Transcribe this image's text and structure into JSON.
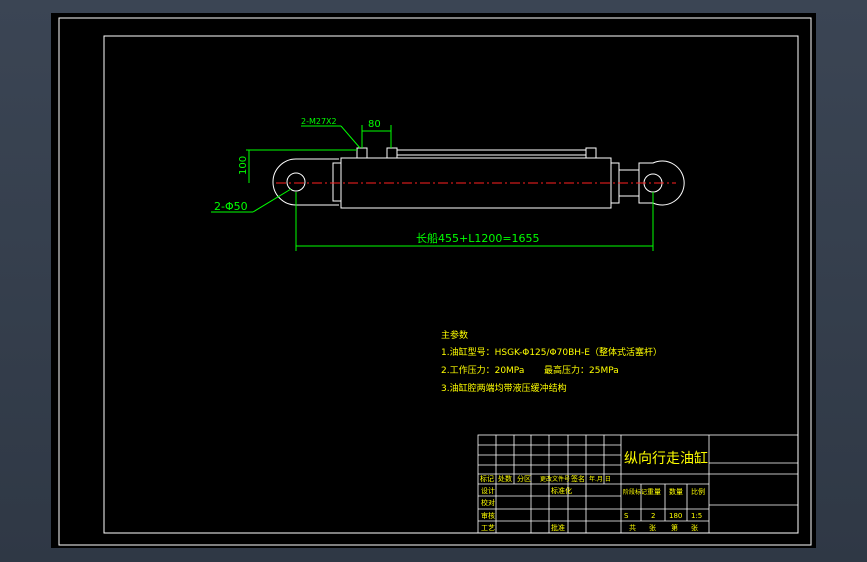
{
  "drawing": {
    "dims": {
      "thread": "2-M27X2",
      "port_spacing": "80",
      "height": "100",
      "pin_hole": "2-Φ50",
      "length": "长船455+L1200=1655"
    },
    "notes": {
      "heading": "主参数",
      "line1": "1.油缸型号：HSGK-Φ125/Φ70BH-E（整体式活塞杆）",
      "line2a": "2.工作压力：20MPa",
      "line2b": "最高压力：25MPa",
      "line3": "3.油缸腔两端均带液压缓冲结构"
    },
    "title_block": {
      "title": "纵向行走油缸",
      "label_ji": "标记",
      "label_chushu": "处数",
      "label_fenqu": "分区",
      "label_gengwen": "更改文件号",
      "label_qianming": "签名",
      "label_date": "年.月.日",
      "label_sheji": "设计",
      "label_biaozhun": "标准化",
      "label_jiaodui": "校对",
      "label_shenhe": "审核",
      "label_gongyi": "工艺",
      "label_pizhun": "批准",
      "label_jieduan": "阶段标记",
      "label_zhongliang": "重量",
      "label_shuliang": "数量",
      "label_bili": "比例",
      "val_s": "S",
      "val_2": "2",
      "val_180": "180",
      "val_scale": "1:5",
      "label_gong": "共",
      "label_zhang": "张",
      "label_di": "第",
      "label_zhang2": "张"
    }
  },
  "colors": {
    "outline": "#ffffff",
    "dimension": "#00ff00",
    "centerline": "#ff2020",
    "text": "#ffff00"
  }
}
